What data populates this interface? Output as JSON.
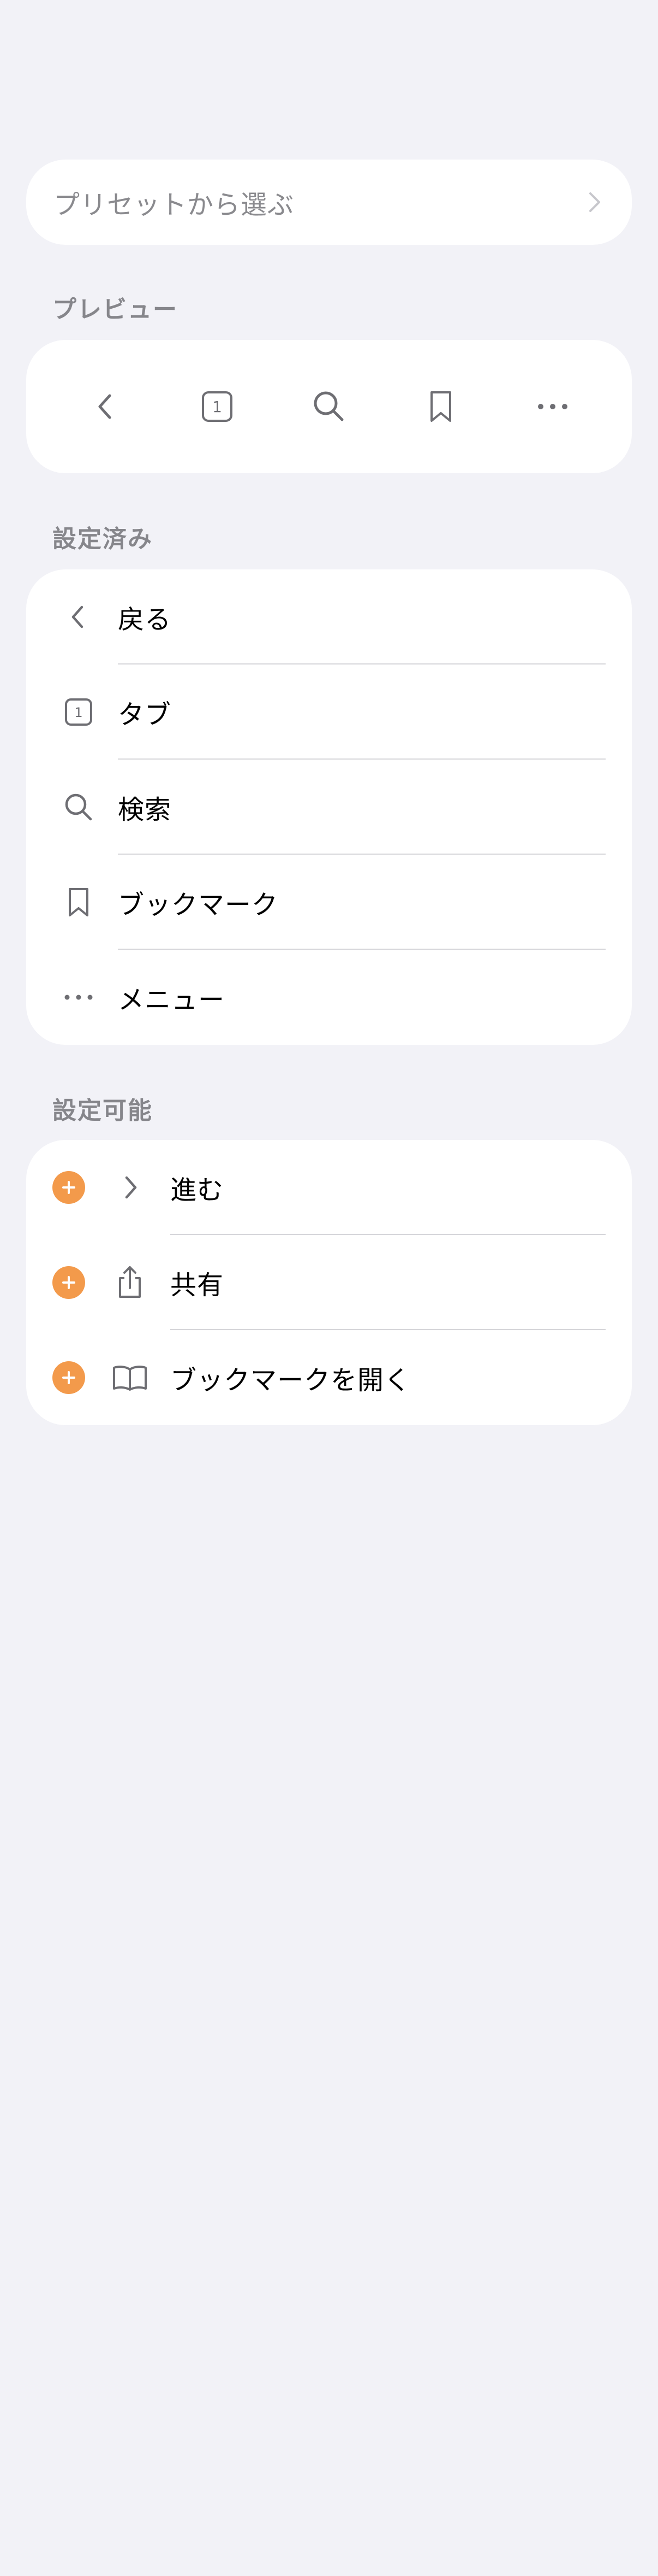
{
  "preset": {
    "label": "プリセットから選ぶ",
    "chevron_icon": "chevron-right-icon"
  },
  "preview": {
    "header": "プレビュー",
    "buttons": [
      {
        "name": "back",
        "icon": "chevron-left-icon"
      },
      {
        "name": "tabs",
        "icon": "tab-count-icon",
        "count": "1"
      },
      {
        "name": "search",
        "icon": "search-icon"
      },
      {
        "name": "bookmark",
        "icon": "bookmark-icon"
      },
      {
        "name": "menu",
        "icon": "more-dots-icon"
      }
    ]
  },
  "configured": {
    "header": "設定済み",
    "items": [
      {
        "label": "戻る",
        "icon": "chevron-left-icon"
      },
      {
        "label": "タブ",
        "icon": "tab-count-icon",
        "count": "1"
      },
      {
        "label": "検索",
        "icon": "search-icon"
      },
      {
        "label": "ブックマーク",
        "icon": "bookmark-icon"
      },
      {
        "label": "メニュー",
        "icon": "more-dots-icon"
      }
    ]
  },
  "available": {
    "header": "設定可能",
    "items": [
      {
        "label": "進む",
        "icon": "chevron-right-icon",
        "action_icon": "add-circle-icon"
      },
      {
        "label": "共有",
        "icon": "share-icon",
        "action_icon": "add-circle-icon"
      },
      {
        "label": "ブックマークを開く",
        "icon": "book-open-icon",
        "action_icon": "add-circle-icon"
      }
    ]
  },
  "colors": {
    "background": "#f2f2f7",
    "card": "#ffffff",
    "icon_gray": "#6e6e73",
    "header_gray": "#86868b",
    "add_orange": "#f39a4b",
    "separator": "#d6d6da"
  }
}
